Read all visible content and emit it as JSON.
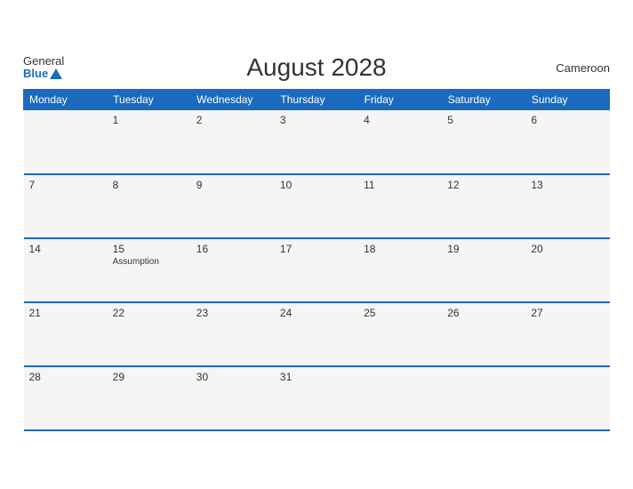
{
  "header": {
    "logo_general": "General",
    "logo_blue": "Blue",
    "title": "August 2028",
    "country": "Cameroon"
  },
  "weekdays": [
    "Monday",
    "Tuesday",
    "Wednesday",
    "Thursday",
    "Friday",
    "Saturday",
    "Sunday"
  ],
  "weeks": [
    [
      {
        "day": "",
        "holiday": ""
      },
      {
        "day": "1",
        "holiday": ""
      },
      {
        "day": "2",
        "holiday": ""
      },
      {
        "day": "3",
        "holiday": ""
      },
      {
        "day": "4",
        "holiday": ""
      },
      {
        "day": "5",
        "holiday": ""
      },
      {
        "day": "6",
        "holiday": ""
      }
    ],
    [
      {
        "day": "7",
        "holiday": ""
      },
      {
        "day": "8",
        "holiday": ""
      },
      {
        "day": "9",
        "holiday": ""
      },
      {
        "day": "10",
        "holiday": ""
      },
      {
        "day": "11",
        "holiday": ""
      },
      {
        "day": "12",
        "holiday": ""
      },
      {
        "day": "13",
        "holiday": ""
      }
    ],
    [
      {
        "day": "14",
        "holiday": ""
      },
      {
        "day": "15",
        "holiday": "Assumption"
      },
      {
        "day": "16",
        "holiday": ""
      },
      {
        "day": "17",
        "holiday": ""
      },
      {
        "day": "18",
        "holiday": ""
      },
      {
        "day": "19",
        "holiday": ""
      },
      {
        "day": "20",
        "holiday": ""
      }
    ],
    [
      {
        "day": "21",
        "holiday": ""
      },
      {
        "day": "22",
        "holiday": ""
      },
      {
        "day": "23",
        "holiday": ""
      },
      {
        "day": "24",
        "holiday": ""
      },
      {
        "day": "25",
        "holiday": ""
      },
      {
        "day": "26",
        "holiday": ""
      },
      {
        "day": "27",
        "holiday": ""
      }
    ],
    [
      {
        "day": "28",
        "holiday": ""
      },
      {
        "day": "29",
        "holiday": ""
      },
      {
        "day": "30",
        "holiday": ""
      },
      {
        "day": "31",
        "holiday": ""
      },
      {
        "day": "",
        "holiday": ""
      },
      {
        "day": "",
        "holiday": ""
      },
      {
        "day": "",
        "holiday": ""
      }
    ]
  ]
}
